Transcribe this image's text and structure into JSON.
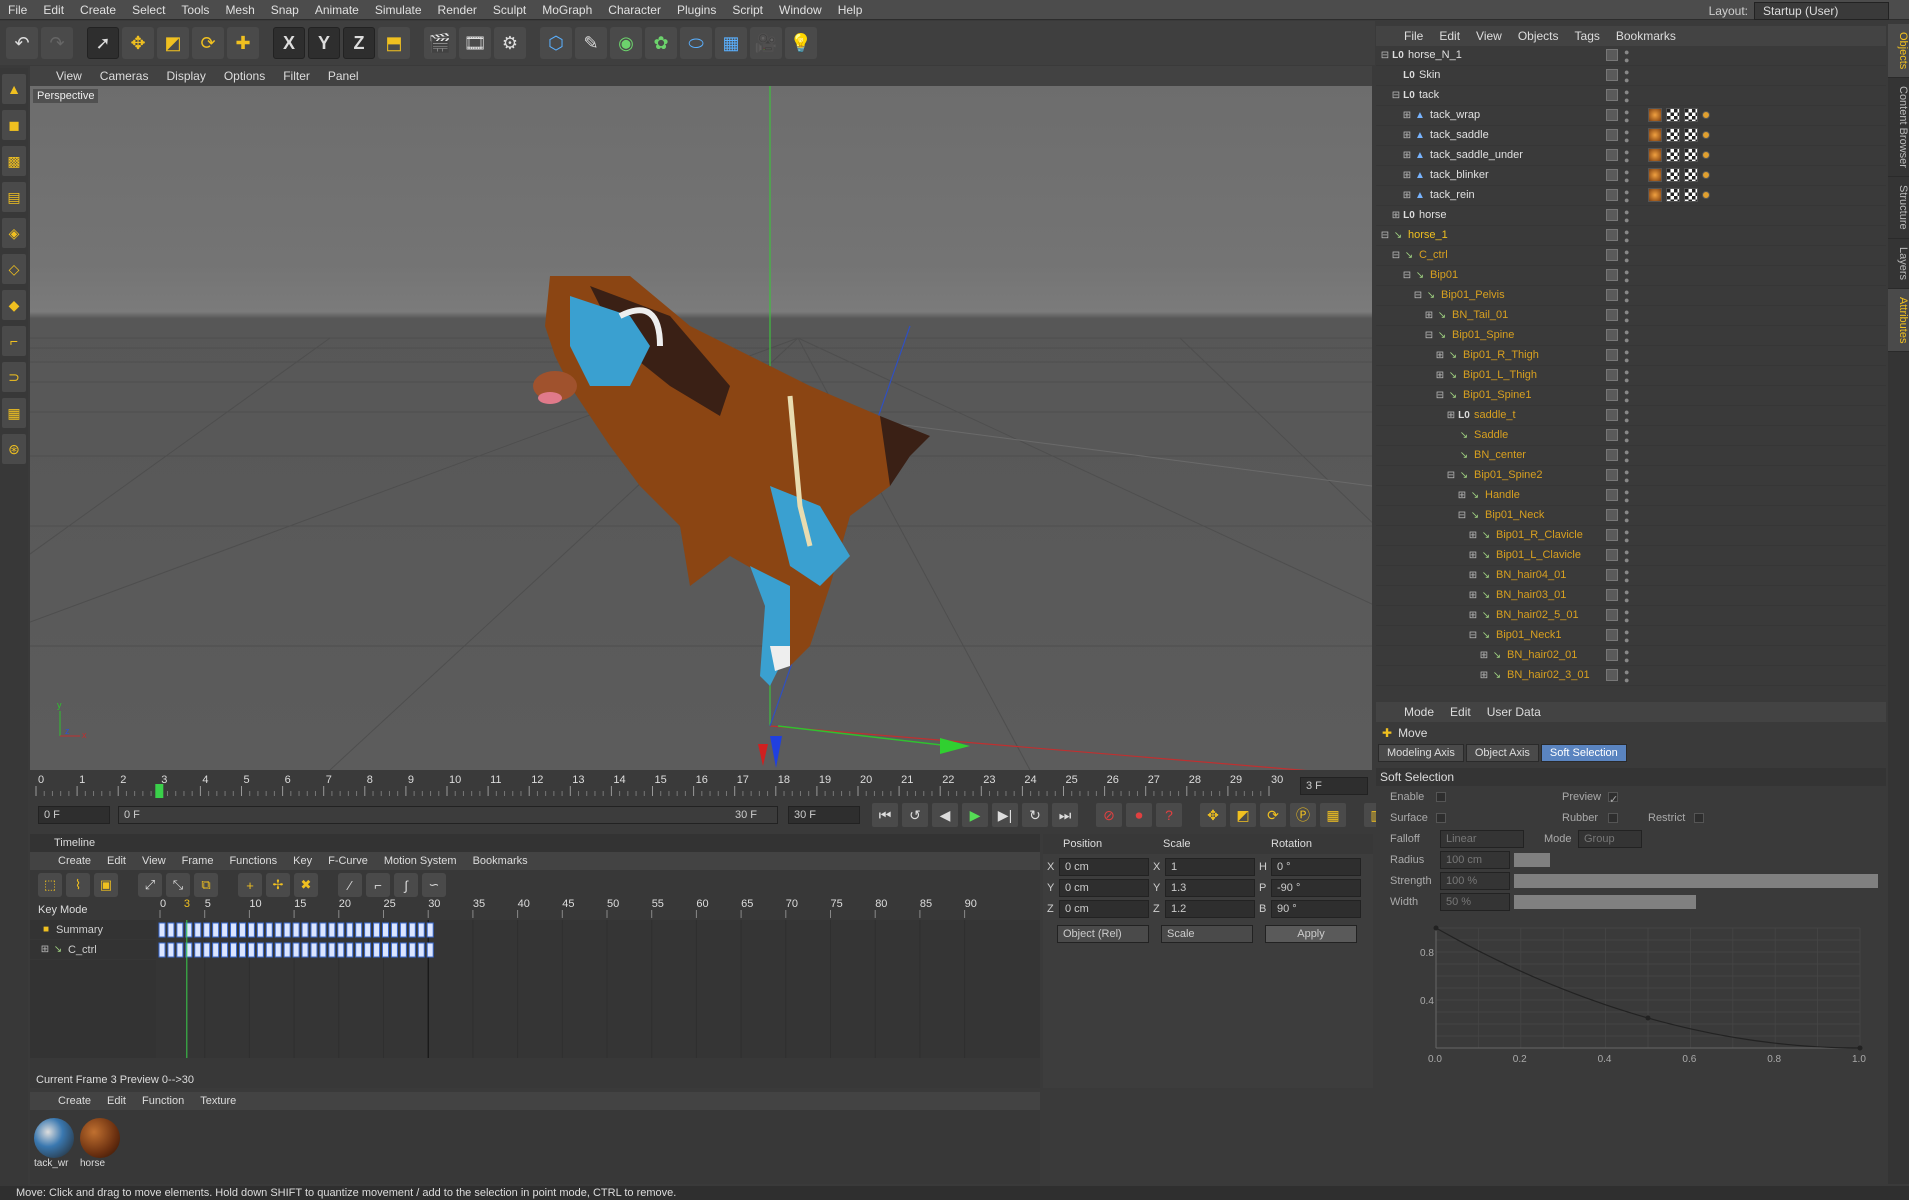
{
  "menubar": {
    "items": [
      "File",
      "Edit",
      "Create",
      "Select",
      "Tools",
      "Mesh",
      "Snap",
      "Animate",
      "Simulate",
      "Render",
      "Sculpt",
      "MoGraph",
      "Character",
      "Plugins",
      "Script",
      "Window",
      "Help"
    ],
    "layout_label": "Layout:",
    "layout_value": "Startup (User)"
  },
  "viewport": {
    "menu": [
      "View",
      "Cameras",
      "Display",
      "Options",
      "Filter",
      "Panel"
    ],
    "label": "Perspective"
  },
  "ruler": {
    "ticks": [
      "0",
      "1",
      "2",
      "3",
      "4",
      "5",
      "6",
      "7",
      "8",
      "9",
      "10",
      "11",
      "12",
      "13",
      "14",
      "15",
      "16",
      "17",
      "18",
      "19",
      "20",
      "21",
      "22",
      "23",
      "24",
      "25",
      "26",
      "27",
      "28",
      "29",
      "30"
    ],
    "current_frame_field": "3 F",
    "current": 3
  },
  "timectrl": {
    "start": "0 F",
    "range_start": "0 F",
    "range_end": "30 F",
    "end": "30 F"
  },
  "timeline": {
    "title": "Timeline",
    "menu": [
      "Create",
      "Edit",
      "View",
      "Frame",
      "Functions",
      "Key",
      "F-Curve",
      "Motion System",
      "Bookmarks"
    ],
    "mode": "Key Mode",
    "ticks": [
      "0",
      "5",
      "10",
      "15",
      "20",
      "25",
      "30",
      "35",
      "40",
      "45",
      "50",
      "55",
      "60",
      "65",
      "70",
      "75",
      "80",
      "85",
      "90"
    ],
    "current": "3",
    "tracks": [
      {
        "name": "Summary"
      },
      {
        "name": "C_ctrl"
      }
    ],
    "status": "Current Frame  3  Preview  0-->30"
  },
  "coords": {
    "headers": [
      "Position",
      "Scale",
      "Rotation"
    ],
    "rows": [
      {
        "axis": "X",
        "pos": "0 cm",
        "saxis": "X",
        "scale": "1",
        "raxis": "H",
        "rot": "0 °"
      },
      {
        "axis": "Y",
        "pos": "0 cm",
        "saxis": "Y",
        "scale": "1.3",
        "raxis": "P",
        "rot": "-90 °"
      },
      {
        "axis": "Z",
        "pos": "0 cm",
        "saxis": "Z",
        "scale": "1.2",
        "raxis": "B",
        "rot": "90 °"
      }
    ],
    "mode": "Object (Rel)",
    "scale_mode": "Scale",
    "apply": "Apply"
  },
  "material": {
    "menu": [
      "Create",
      "Edit",
      "Function",
      "Texture"
    ],
    "items": [
      {
        "name": "tack_wr"
      },
      {
        "name": "horse"
      }
    ]
  },
  "status": "Move: Click and drag to move elements. Hold down SHIFT to quantize movement / add to the selection in point mode, CTRL to remove.",
  "objects": {
    "menu": [
      "File",
      "Edit",
      "View",
      "Objects",
      "Tags",
      "Bookmarks"
    ],
    "rows": [
      {
        "name": "horse_N_1",
        "indent": 0,
        "type": "null",
        "exp": "⊟",
        "tags": false
      },
      {
        "name": "Skin",
        "indent": 1,
        "type": "null",
        "exp": "",
        "tags": false
      },
      {
        "name": "tack",
        "indent": 1,
        "type": "null",
        "exp": "⊟",
        "tags": false
      },
      {
        "name": "tack_wrap",
        "indent": 2,
        "type": "poly",
        "exp": "⊞",
        "tags": true
      },
      {
        "name": "tack_saddle",
        "indent": 2,
        "type": "poly",
        "exp": "⊞",
        "tags": true
      },
      {
        "name": "tack_saddle_under",
        "indent": 2,
        "type": "poly",
        "exp": "⊞",
        "tags": true
      },
      {
        "name": "tack_blinker",
        "indent": 2,
        "type": "poly",
        "exp": "⊞",
        "tags": true
      },
      {
        "name": "tack_rein",
        "indent": 2,
        "type": "poly",
        "exp": "⊞",
        "tags": true
      },
      {
        "name": "horse",
        "indent": 1,
        "type": "null",
        "exp": "⊞",
        "tags": false
      },
      {
        "name": "horse_1",
        "indent": 0,
        "type": "horse1",
        "exp": "⊟",
        "tags": false
      },
      {
        "name": "C_ctrl",
        "indent": 1,
        "type": "bone",
        "exp": "⊟",
        "tags": false
      },
      {
        "name": "Bip01",
        "indent": 2,
        "type": "bone",
        "exp": "⊟",
        "tags": false
      },
      {
        "name": "Bip01_Pelvis",
        "indent": 3,
        "type": "bone",
        "exp": "⊟",
        "tags": false
      },
      {
        "name": "BN_Tail_01",
        "indent": 4,
        "type": "bone",
        "exp": "⊞",
        "tags": false
      },
      {
        "name": "Bip01_Spine",
        "indent": 4,
        "type": "bone",
        "exp": "⊟",
        "tags": false
      },
      {
        "name": "Bip01_R_Thigh",
        "indent": 5,
        "type": "bone",
        "exp": "⊞",
        "tags": false
      },
      {
        "name": "Bip01_L_Thigh",
        "indent": 5,
        "type": "bone",
        "exp": "⊞",
        "tags": false
      },
      {
        "name": "Bip01_Spine1",
        "indent": 5,
        "type": "bone",
        "exp": "⊟",
        "tags": false
      },
      {
        "name": "saddle_t",
        "indent": 6,
        "type": "bnull",
        "exp": "⊞",
        "tags": false
      },
      {
        "name": "Saddle",
        "indent": 6,
        "type": "bone",
        "exp": "",
        "tags": false
      },
      {
        "name": "BN_center",
        "indent": 6,
        "type": "bone",
        "exp": "",
        "tags": false
      },
      {
        "name": "Bip01_Spine2",
        "indent": 6,
        "type": "bone",
        "exp": "⊟",
        "tags": false
      },
      {
        "name": "Handle",
        "indent": 7,
        "type": "bone",
        "exp": "⊞",
        "tags": false
      },
      {
        "name": "Bip01_Neck",
        "indent": 7,
        "type": "bone",
        "exp": "⊟",
        "tags": false
      },
      {
        "name": "Bip01_R_Clavicle",
        "indent": 8,
        "type": "bone",
        "exp": "⊞",
        "tags": false
      },
      {
        "name": "Bip01_L_Clavicle",
        "indent": 8,
        "type": "bone",
        "exp": "⊞",
        "tags": false
      },
      {
        "name": "BN_hair04_01",
        "indent": 8,
        "type": "bone",
        "exp": "⊞",
        "tags": false
      },
      {
        "name": "BN_hair03_01",
        "indent": 8,
        "type": "bone",
        "exp": "⊞",
        "tags": false
      },
      {
        "name": "BN_hair02_5_01",
        "indent": 8,
        "type": "bone",
        "exp": "⊞",
        "tags": false
      },
      {
        "name": "Bip01_Neck1",
        "indent": 8,
        "type": "bone",
        "exp": "⊟",
        "tags": false
      },
      {
        "name": "BN_hair02_01",
        "indent": 9,
        "type": "bone",
        "exp": "⊞",
        "tags": false
      },
      {
        "name": "BN_hair02_3_01",
        "indent": 9,
        "type": "bone",
        "exp": "⊞",
        "tags": false
      }
    ]
  },
  "attributes": {
    "menu": [
      "Mode",
      "Edit",
      "User Data"
    ],
    "tool": "Move",
    "tabs": [
      "Modeling Axis",
      "Object Axis",
      "Soft Selection"
    ],
    "section": "Soft Selection",
    "enable": "Enable",
    "preview": "Preview",
    "surface": "Surface",
    "rubber": "Rubber",
    "restrict": "Restrict",
    "falloff": "Falloff",
    "falloff_val": "Linear",
    "mode": "Mode",
    "mode_val": "Group",
    "radius": "Radius",
    "radius_val": "100 cm",
    "strength": "Strength",
    "strength_val": "100 %",
    "width": "Width",
    "width_val": "50 %",
    "graph_y": [
      "0.8",
      "0.4"
    ],
    "graph_x": [
      "0.0",
      "0.2",
      "0.4",
      "0.6",
      "0.8",
      "1.0"
    ]
  },
  "rightstrip": [
    "Objects",
    "Content Browser",
    "Structure",
    "Layers",
    "Attributes"
  ]
}
